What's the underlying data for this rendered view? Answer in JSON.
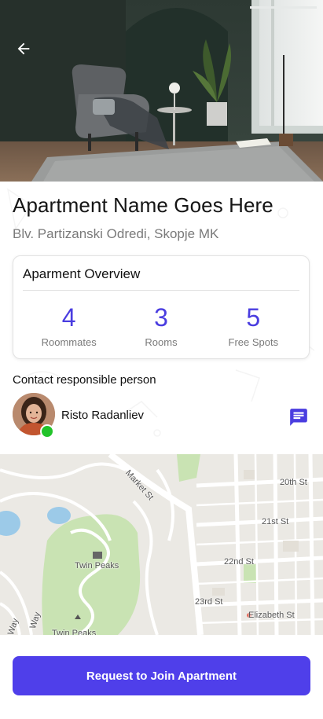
{
  "apartment": {
    "title": "Apartment Name Goes Here",
    "address": "Blv. Partizanski Odredi, Skopje MK"
  },
  "overview": {
    "title": "Aparment Overview",
    "stats": [
      {
        "value": "4",
        "label": "Roommates"
      },
      {
        "value": "3",
        "label": "Rooms"
      },
      {
        "value": "5",
        "label": "Free Spots"
      }
    ]
  },
  "contact": {
    "heading": "Contact responsible person",
    "name": "Risto Radanliev",
    "online": true
  },
  "map": {
    "labels": [
      "Market St",
      "20th St",
      "21st St",
      "22nd St",
      "23rd St",
      "Elizabeth St",
      "Twin Peaks",
      "Twin Peaks",
      "Way",
      "Way"
    ]
  },
  "cta": {
    "label": "Request to Join Apartment"
  },
  "colors": {
    "accent": "#4f3fea",
    "stat": "#4a3de0",
    "online": "#22c32a"
  },
  "icons": {
    "back": "arrow-left-icon",
    "message": "chat-bubble-icon"
  }
}
